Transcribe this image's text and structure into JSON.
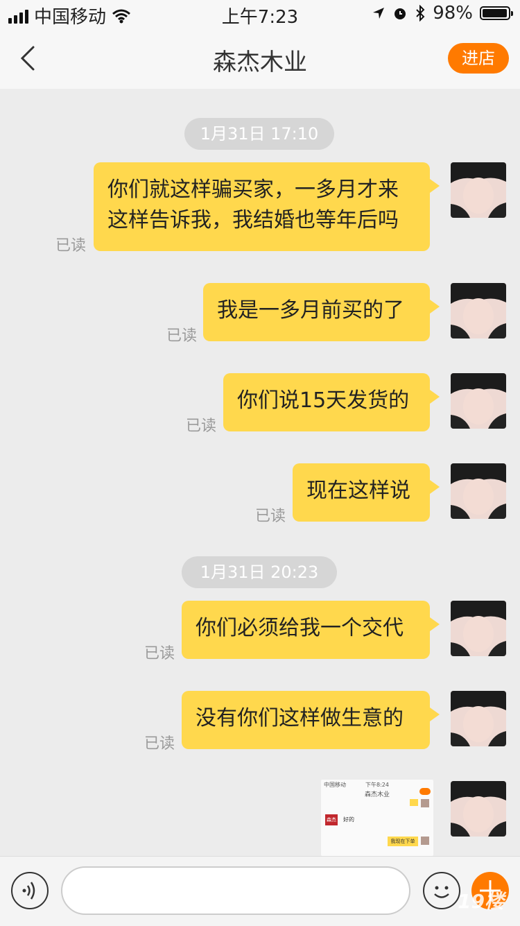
{
  "status": {
    "carrier": "中国移动",
    "time": "上午7:23",
    "battery": "98%",
    "battery_level": 0.98
  },
  "nav": {
    "title": "森杰木业",
    "enter_label": "进店"
  },
  "chat": {
    "timestamps": [
      "1月31日 17:10",
      "1月31日 20:23"
    ],
    "messages": [
      {
        "text": "你们就这样骗买家，一多月才来\n这样告诉我，我结婚也等年后吗",
        "status": "已读"
      },
      {
        "text": "我是一多月前买的了",
        "status": "已读"
      },
      {
        "text": "你们说15天发货的",
        "status": "已读"
      },
      {
        "text": "现在这样说",
        "status": "已读"
      },
      {
        "text": "你们必须给我一个交代",
        "status": "已读"
      },
      {
        "text": "没有你们这样做生意的",
        "status": "已读"
      }
    ],
    "image_message": {
      "status_carrier": "中国移动",
      "status_time": "下午8:24",
      "title": "森杰木业",
      "shop_logo": "森杰",
      "reply": "好的",
      "my_message": "我现在下单"
    }
  },
  "watermark": "19楼"
}
